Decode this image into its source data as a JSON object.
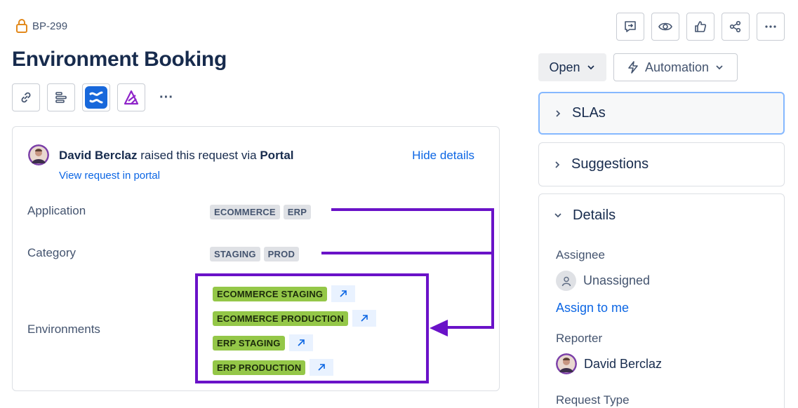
{
  "issue": {
    "key": "BP-299",
    "title": "Environment Booking"
  },
  "request": {
    "reporter": "David Berclaz",
    "raised_text": "raised this request via",
    "channel": "Portal",
    "view_link": "View request in portal",
    "hide_details": "Hide details"
  },
  "fields": {
    "application": {
      "label": "Application",
      "tags": [
        "ECOMMERCE",
        "ERP"
      ]
    },
    "category": {
      "label": "Category",
      "tags": [
        "STAGING",
        "PROD"
      ]
    },
    "environments": {
      "label": "Environments",
      "items": [
        "ECOMMERCE STAGING",
        "ECOMMERCE PRODUCTION",
        "ERP STAGING",
        "ERP PRODUCTION"
      ]
    }
  },
  "sidebar": {
    "status": "Open",
    "automation": "Automation",
    "slas": "SLAs",
    "suggestions": "Suggestions",
    "details": "Details",
    "assignee_label": "Assignee",
    "assignee_value": "Unassigned",
    "assign_to_me": "Assign to me",
    "reporter_label": "Reporter",
    "reporter_value": "David Berclaz",
    "request_type_label": "Request Type"
  },
  "toolbar_icons": [
    "link-icon",
    "child-issues-icon",
    "confluence-icon",
    "jira-align-icon",
    "more-icon"
  ],
  "top_action_icons": [
    "give-feedback-icon",
    "watch-icon",
    "like-icon",
    "share-icon",
    "more-actions-icon"
  ],
  "colors": {
    "accent": "#0c66e4",
    "annotation": "#6a12c8",
    "env_tag": "#94c748",
    "tag": "#dfe1e5",
    "lock": "#e2891c"
  }
}
